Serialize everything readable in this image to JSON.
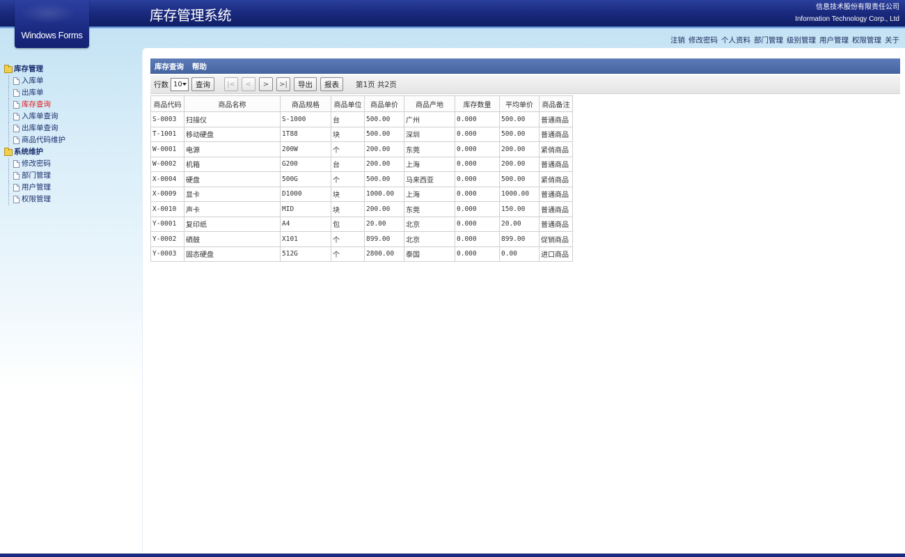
{
  "header": {
    "logo_text": "Windows Forms",
    "app_title": "库存管理系统",
    "company_cn": "信息技术股份有限责任公司",
    "company_en": "Information Technology Corp., Ltd"
  },
  "topnav": [
    "注销",
    "修改密码",
    "个人资料",
    "部门管理",
    "级别管理",
    "用户管理",
    "权限管理",
    "关于"
  ],
  "tree": {
    "groups": [
      {
        "label": "库存管理",
        "items": [
          "入库单",
          "出库单",
          "库存查询",
          "入库单查询",
          "出库单查询",
          "商品代码维护"
        ]
      },
      {
        "label": "系统维护",
        "items": [
          "修改密码",
          "部门管理",
          "用户管理",
          "权限管理"
        ]
      }
    ],
    "active_item": "库存查询"
  },
  "panel": {
    "tabs": [
      "库存查询",
      "帮助"
    ]
  },
  "toolbar": {
    "rows_label": "行数",
    "rows_value": "10",
    "query_btn": "查询",
    "first_btn": "|<",
    "prev_btn": "<",
    "next_btn": ">",
    "last_btn": ">|",
    "export_btn": "导出",
    "report_btn": "报表",
    "page_info": "第1页  共2页"
  },
  "table": {
    "columns": [
      "商品代码",
      "商品名称",
      "商品规格",
      "商品单位",
      "商品单价",
      "商品产地",
      "库存数量",
      "平均单价",
      "商品备注"
    ],
    "rows": [
      [
        "S-0003",
        "扫描仪",
        "S-1000",
        "台",
        "500.00",
        "广州",
        "0.000",
        "500.00",
        "普通商品"
      ],
      [
        "T-1001",
        "移动硬盘",
        "1T88",
        "块",
        "500.00",
        "深圳",
        "0.000",
        "500.00",
        "普通商品"
      ],
      [
        "W-0001",
        "电源",
        "200W",
        "个",
        "200.00",
        "东莞",
        "0.000",
        "200.00",
        "紧俏商品"
      ],
      [
        "W-0002",
        "机箱",
        "G200",
        "台",
        "200.00",
        "上海",
        "0.000",
        "200.00",
        "普通商品"
      ],
      [
        "X-0004",
        "硬盘",
        "500G",
        "个",
        "500.00",
        "马来西亚",
        "0.000",
        "500.00",
        "紧俏商品"
      ],
      [
        "X-0009",
        "显卡",
        "D1000",
        "块",
        "1000.00",
        "上海",
        "0.000",
        "1000.00",
        "普通商品"
      ],
      [
        "X-0010",
        "声卡",
        "MID",
        "块",
        "200.00",
        "东莞",
        "0.000",
        "150.00",
        "普通商品"
      ],
      [
        "Y-0001",
        "复印纸",
        "A4",
        "包",
        "20.00",
        "北京",
        "0.000",
        "20.00",
        "普通商品"
      ],
      [
        "Y-0002",
        "硒鼓",
        "X101",
        "个",
        "899.00",
        "北京",
        "0.000",
        "899.00",
        "促销商品"
      ],
      [
        "Y-0003",
        "固态硬盘",
        "512G",
        "个",
        "2800.00",
        "泰国",
        "0.000",
        "0.00",
        "进口商品"
      ]
    ]
  },
  "colors": {
    "header_bg": "#1a2a7e",
    "panel_head_bg": "#45639f",
    "active_link": "#e02020"
  }
}
